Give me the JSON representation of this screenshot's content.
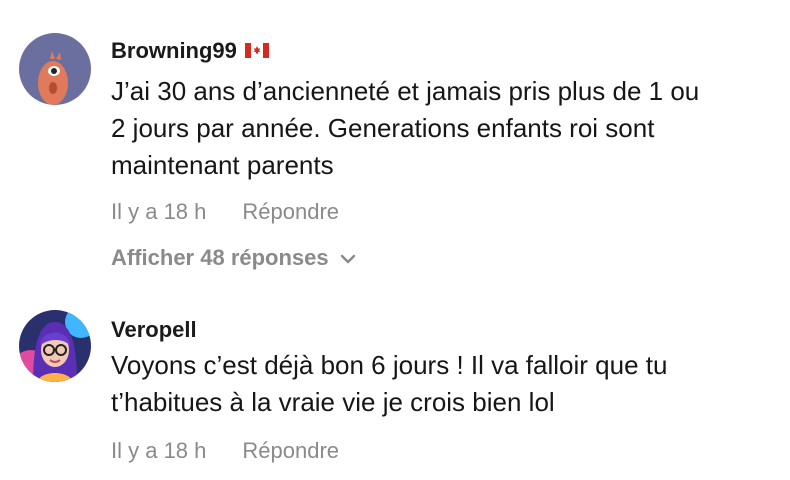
{
  "comments": [
    {
      "username": "Browning99",
      "flag": "canada-flag-icon",
      "text_lines": [
        "J’ai 30 ans d’ancienneté et jamais pris plus de 1 ou",
        "2 jours par année. Generations enfants roi sont",
        "maintenant parents"
      ],
      "time": "Il y a 18 h",
      "reply_label": "Répondre",
      "view_replies_label": "Afficher 48 réponses"
    },
    {
      "username": "Veropell",
      "text_lines": [
        "Voyons c’est déjà bon 6 jours ! Il va falloir que tu",
        "t’habitues à la vraie vie je crois bien lol"
      ],
      "time": "Il y a 18 h",
      "reply_label": "Répondre"
    }
  ],
  "colors": {
    "meta_text": "#8a8a8a",
    "avatar1_bg": "#6b6fa0",
    "flag_red": "#d52b1e"
  }
}
